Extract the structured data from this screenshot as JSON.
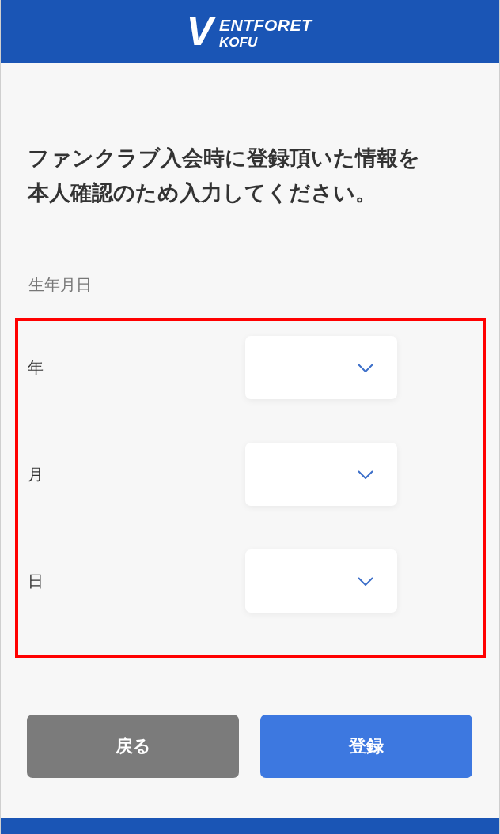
{
  "header": {
    "logo": {
      "mark": "V",
      "line_1": "ENTFORET",
      "line_2": "KOFU"
    }
  },
  "heading": "ファンクラブ入会時に登録頂いた情報を本人確認のため入力してください。",
  "birthdate": {
    "label": "生年月日",
    "highlighted": true,
    "fields": [
      {
        "label": "年"
      },
      {
        "label": "月"
      },
      {
        "label": "日"
      }
    ]
  },
  "buttons": [
    {
      "label": "戻る",
      "kind": "secondary"
    },
    {
      "label": "登録",
      "kind": "primary"
    }
  ]
}
